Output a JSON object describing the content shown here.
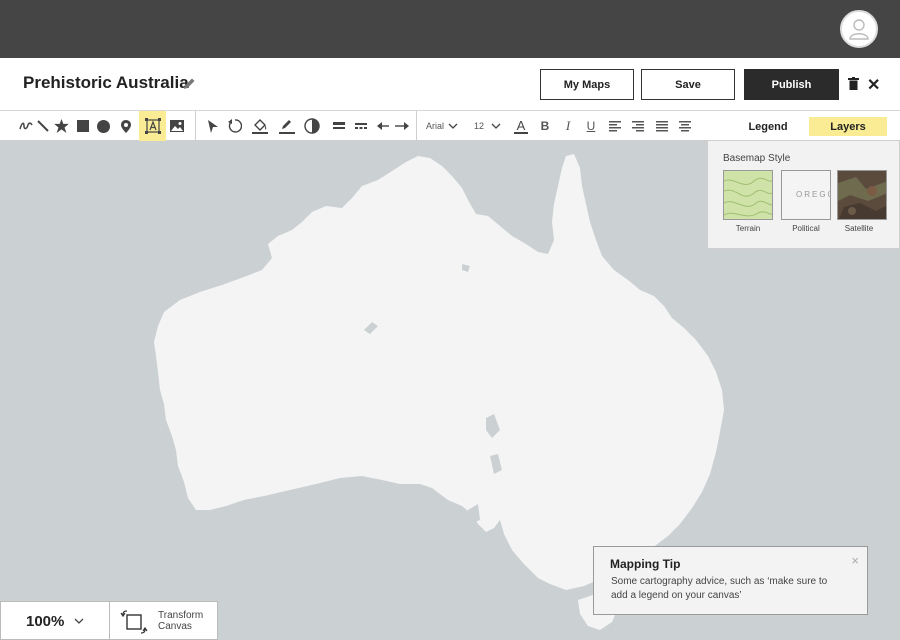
{
  "header": {
    "avatar_icon": "user-icon"
  },
  "titlebar": {
    "title": "Prehistoric Australia",
    "my_maps_label": "My Maps",
    "save_label": "Save",
    "publish_label": "Publish"
  },
  "toolbar": {
    "font_name": "Arial",
    "font_size": "12",
    "bold_glyph": "B",
    "italic_glyph": "I",
    "underline_glyph": "U",
    "text_color_glyph": "A",
    "legend_label": "Legend",
    "layers_label": "Layers"
  },
  "basemap": {
    "title": "Basemap Style",
    "options": [
      {
        "label": "Terrain"
      },
      {
        "label": "Political",
        "thumb_text": "OREGO"
      },
      {
        "label": "Satellite"
      }
    ]
  },
  "tip": {
    "title": "Mapping Tip",
    "text": "Some cartography advice, such as ‘make sure to add a legend on your canvas’",
    "close_glyph": "×"
  },
  "zoom": {
    "value": "100%"
  },
  "transform": {
    "label": "Transform Canvas"
  },
  "colors": {
    "topbar": "#454545",
    "accent_yellow": "#f9ec94",
    "water": "#cbd1d3",
    "land": "#f4f4f4",
    "publish_bg": "#2b2b2b"
  }
}
